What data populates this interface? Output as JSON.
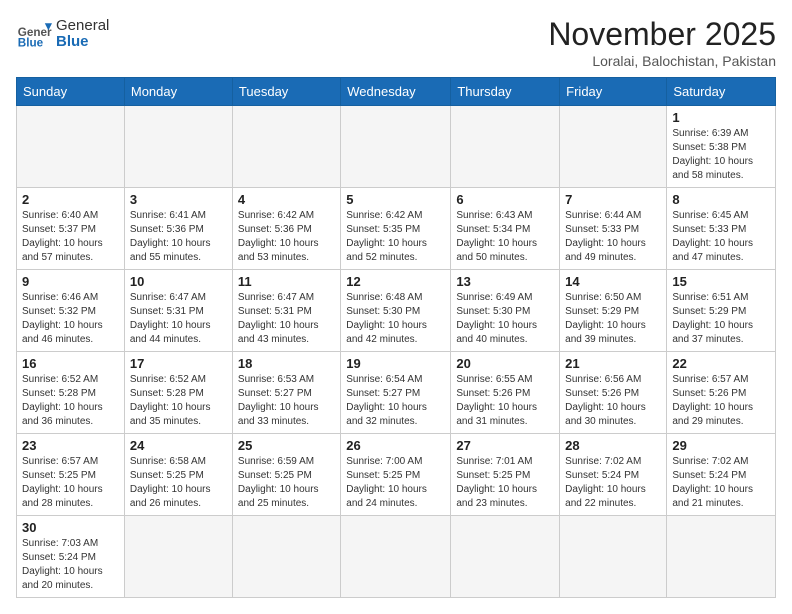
{
  "header": {
    "logo_general": "General",
    "logo_blue": "Blue",
    "month_title": "November 2025",
    "location": "Loralai, Balochistan, Pakistan"
  },
  "days_of_week": [
    "Sunday",
    "Monday",
    "Tuesday",
    "Wednesday",
    "Thursday",
    "Friday",
    "Saturday"
  ],
  "weeks": [
    [
      {
        "day": "",
        "info": ""
      },
      {
        "day": "",
        "info": ""
      },
      {
        "day": "",
        "info": ""
      },
      {
        "day": "",
        "info": ""
      },
      {
        "day": "",
        "info": ""
      },
      {
        "day": "",
        "info": ""
      },
      {
        "day": "1",
        "info": "Sunrise: 6:39 AM\nSunset: 5:38 PM\nDaylight: 10 hours and 58 minutes."
      }
    ],
    [
      {
        "day": "2",
        "info": "Sunrise: 6:40 AM\nSunset: 5:37 PM\nDaylight: 10 hours and 57 minutes."
      },
      {
        "day": "3",
        "info": "Sunrise: 6:41 AM\nSunset: 5:36 PM\nDaylight: 10 hours and 55 minutes."
      },
      {
        "day": "4",
        "info": "Sunrise: 6:42 AM\nSunset: 5:36 PM\nDaylight: 10 hours and 53 minutes."
      },
      {
        "day": "5",
        "info": "Sunrise: 6:42 AM\nSunset: 5:35 PM\nDaylight: 10 hours and 52 minutes."
      },
      {
        "day": "6",
        "info": "Sunrise: 6:43 AM\nSunset: 5:34 PM\nDaylight: 10 hours and 50 minutes."
      },
      {
        "day": "7",
        "info": "Sunrise: 6:44 AM\nSunset: 5:33 PM\nDaylight: 10 hours and 49 minutes."
      },
      {
        "day": "8",
        "info": "Sunrise: 6:45 AM\nSunset: 5:33 PM\nDaylight: 10 hours and 47 minutes."
      }
    ],
    [
      {
        "day": "9",
        "info": "Sunrise: 6:46 AM\nSunset: 5:32 PM\nDaylight: 10 hours and 46 minutes."
      },
      {
        "day": "10",
        "info": "Sunrise: 6:47 AM\nSunset: 5:31 PM\nDaylight: 10 hours and 44 minutes."
      },
      {
        "day": "11",
        "info": "Sunrise: 6:47 AM\nSunset: 5:31 PM\nDaylight: 10 hours and 43 minutes."
      },
      {
        "day": "12",
        "info": "Sunrise: 6:48 AM\nSunset: 5:30 PM\nDaylight: 10 hours and 42 minutes."
      },
      {
        "day": "13",
        "info": "Sunrise: 6:49 AM\nSunset: 5:30 PM\nDaylight: 10 hours and 40 minutes."
      },
      {
        "day": "14",
        "info": "Sunrise: 6:50 AM\nSunset: 5:29 PM\nDaylight: 10 hours and 39 minutes."
      },
      {
        "day": "15",
        "info": "Sunrise: 6:51 AM\nSunset: 5:29 PM\nDaylight: 10 hours and 37 minutes."
      }
    ],
    [
      {
        "day": "16",
        "info": "Sunrise: 6:52 AM\nSunset: 5:28 PM\nDaylight: 10 hours and 36 minutes."
      },
      {
        "day": "17",
        "info": "Sunrise: 6:52 AM\nSunset: 5:28 PM\nDaylight: 10 hours and 35 minutes."
      },
      {
        "day": "18",
        "info": "Sunrise: 6:53 AM\nSunset: 5:27 PM\nDaylight: 10 hours and 33 minutes."
      },
      {
        "day": "19",
        "info": "Sunrise: 6:54 AM\nSunset: 5:27 PM\nDaylight: 10 hours and 32 minutes."
      },
      {
        "day": "20",
        "info": "Sunrise: 6:55 AM\nSunset: 5:26 PM\nDaylight: 10 hours and 31 minutes."
      },
      {
        "day": "21",
        "info": "Sunrise: 6:56 AM\nSunset: 5:26 PM\nDaylight: 10 hours and 30 minutes."
      },
      {
        "day": "22",
        "info": "Sunrise: 6:57 AM\nSunset: 5:26 PM\nDaylight: 10 hours and 29 minutes."
      }
    ],
    [
      {
        "day": "23",
        "info": "Sunrise: 6:57 AM\nSunset: 5:25 PM\nDaylight: 10 hours and 28 minutes."
      },
      {
        "day": "24",
        "info": "Sunrise: 6:58 AM\nSunset: 5:25 PM\nDaylight: 10 hours and 26 minutes."
      },
      {
        "day": "25",
        "info": "Sunrise: 6:59 AM\nSunset: 5:25 PM\nDaylight: 10 hours and 25 minutes."
      },
      {
        "day": "26",
        "info": "Sunrise: 7:00 AM\nSunset: 5:25 PM\nDaylight: 10 hours and 24 minutes."
      },
      {
        "day": "27",
        "info": "Sunrise: 7:01 AM\nSunset: 5:25 PM\nDaylight: 10 hours and 23 minutes."
      },
      {
        "day": "28",
        "info": "Sunrise: 7:02 AM\nSunset: 5:24 PM\nDaylight: 10 hours and 22 minutes."
      },
      {
        "day": "29",
        "info": "Sunrise: 7:02 AM\nSunset: 5:24 PM\nDaylight: 10 hours and 21 minutes."
      }
    ],
    [
      {
        "day": "30",
        "info": "Sunrise: 7:03 AM\nSunset: 5:24 PM\nDaylight: 10 hours and 20 minutes."
      },
      {
        "day": "",
        "info": ""
      },
      {
        "day": "",
        "info": ""
      },
      {
        "day": "",
        "info": ""
      },
      {
        "day": "",
        "info": ""
      },
      {
        "day": "",
        "info": ""
      },
      {
        "day": "",
        "info": ""
      }
    ]
  ]
}
